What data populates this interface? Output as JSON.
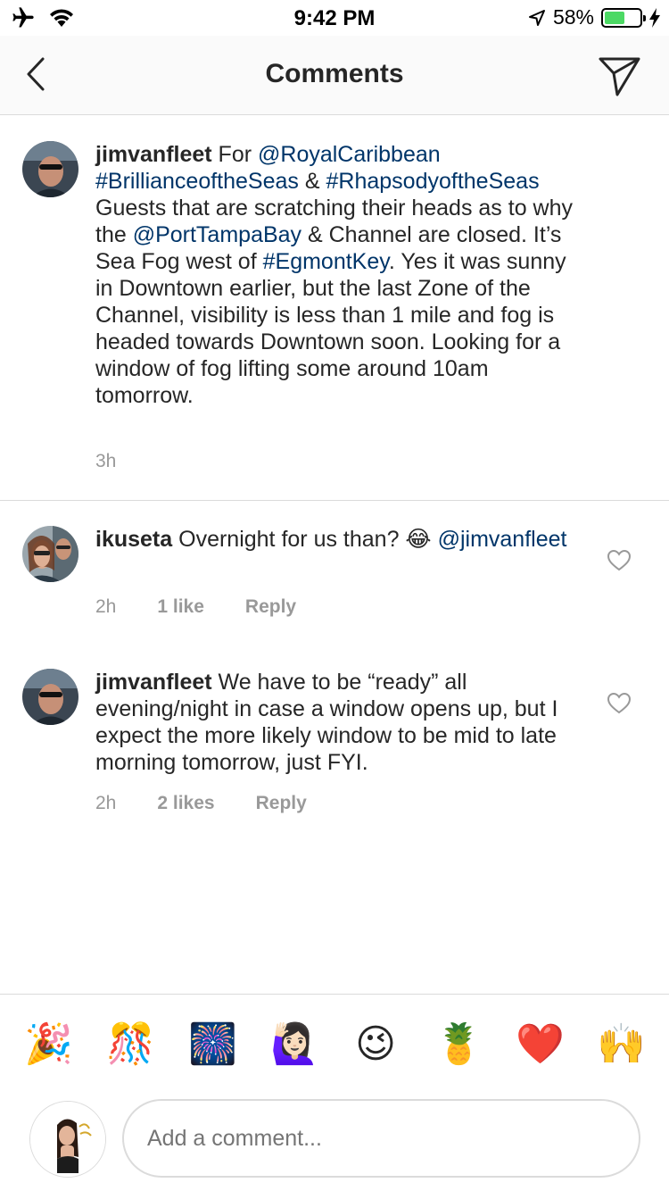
{
  "status_bar": {
    "time": "9:42 PM",
    "battery_percent": "58%",
    "battery_level": 0.58,
    "icons": [
      "airplane-icon",
      "wifi-icon",
      "location-arrow-icon",
      "battery-icon",
      "charging-bolt-icon"
    ]
  },
  "nav": {
    "title": "Comments",
    "back_icon": "chevron-left-icon",
    "send_icon": "paper-plane-icon"
  },
  "colors": {
    "link": "#003569",
    "meta": "#999999",
    "text": "#262626",
    "border": "#dbdbdb",
    "battery": "#4cd964"
  },
  "comments": [
    {
      "username": "jimvanfleet",
      "segments": [
        {
          "t": " For ",
          "link": false
        },
        {
          "t": "@RoyalCaribbean",
          "link": true
        },
        {
          "t": " ",
          "link": false
        },
        {
          "t": "#BrillianceoftheSeas",
          "link": true
        },
        {
          "t": " & ",
          "link": false
        },
        {
          "t": "#RhapsodyoftheSeas",
          "link": true
        },
        {
          "t": " Guests that are scratching their heads as to why the ",
          "link": false
        },
        {
          "t": "@PortTampaBay",
          "link": true
        },
        {
          "t": " & Channel are closed. It’s Sea Fog west of ",
          "link": false
        },
        {
          "t": "#EgmontKey",
          "link": true
        },
        {
          "t": ". Yes it was sunny in Downtown earlier, but the last Zone of the Channel, visibility is less than 1 mile and fog is headed towards Downtown soon. Looking for a window of fog lifting some around 10am tomorrow.",
          "link": false
        }
      ],
      "time": "3h"
    },
    {
      "username": "ikuseta",
      "segments": [
        {
          "t": " Overnight for us than? 😂 ",
          "link": false
        },
        {
          "t": "@jimvanfleet",
          "link": true
        }
      ],
      "time": "2h",
      "likes": "1 like",
      "reply": "Reply"
    },
    {
      "username": "jimvanfleet",
      "segments": [
        {
          "t": " We have to be “ready” all evening/night in case a window opens up, but I expect the more likely window to be mid to late morning tomorrow, just FYI.",
          "link": false
        }
      ],
      "time": "2h",
      "likes": "2 likes",
      "reply": "Reply"
    }
  ],
  "emoji_bar": [
    "🎉",
    "🎊",
    "🎆",
    "🙋🏻‍♀️",
    "😉",
    "🍍",
    "❤️",
    "🙌"
  ],
  "composer": {
    "placeholder": "Add a comment...",
    "avatar_icon": "bitmoji-avatar-icon"
  }
}
